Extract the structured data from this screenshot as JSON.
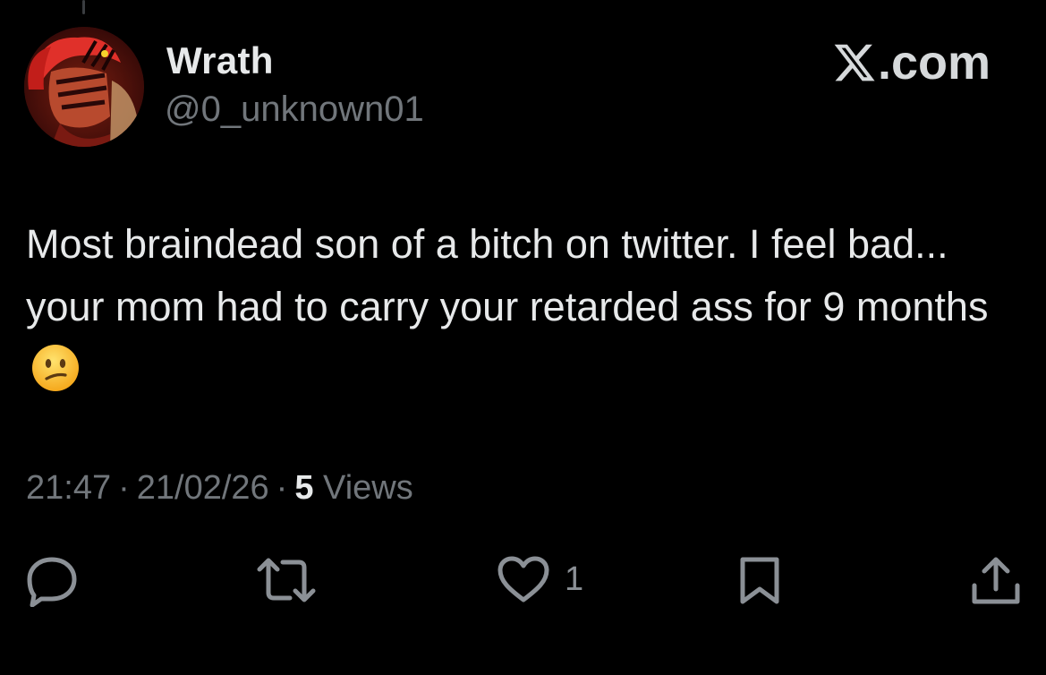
{
  "author": {
    "display_name": "Wrath",
    "handle": "@0_unknown01",
    "avatar": "red-haired-anime-character-avatar"
  },
  "brand": {
    "label": ".com",
    "logo": "x-logo",
    "color": "#d6d9db"
  },
  "tweet": {
    "text": "Most braindead son of a bitch on twitter. I feel bad... your mom had to carry your retarded ass for 9 months",
    "emoji": "confused-face-emoji"
  },
  "meta": {
    "time": "21:47",
    "separator": "·",
    "date": "21/02/26",
    "views_count": "5",
    "views_label": "Views"
  },
  "actions": {
    "reply": {
      "icon": "reply-icon"
    },
    "repost": {
      "icon": "repost-icon"
    },
    "like": {
      "icon": "heart-icon",
      "count": "1"
    },
    "bookmark": {
      "icon": "bookmark-icon"
    },
    "share": {
      "icon": "share-icon"
    }
  },
  "colors": {
    "background": "#000000",
    "text_primary": "#e7e9ea",
    "text_secondary": "#71767b",
    "icon": "#8b9096"
  }
}
